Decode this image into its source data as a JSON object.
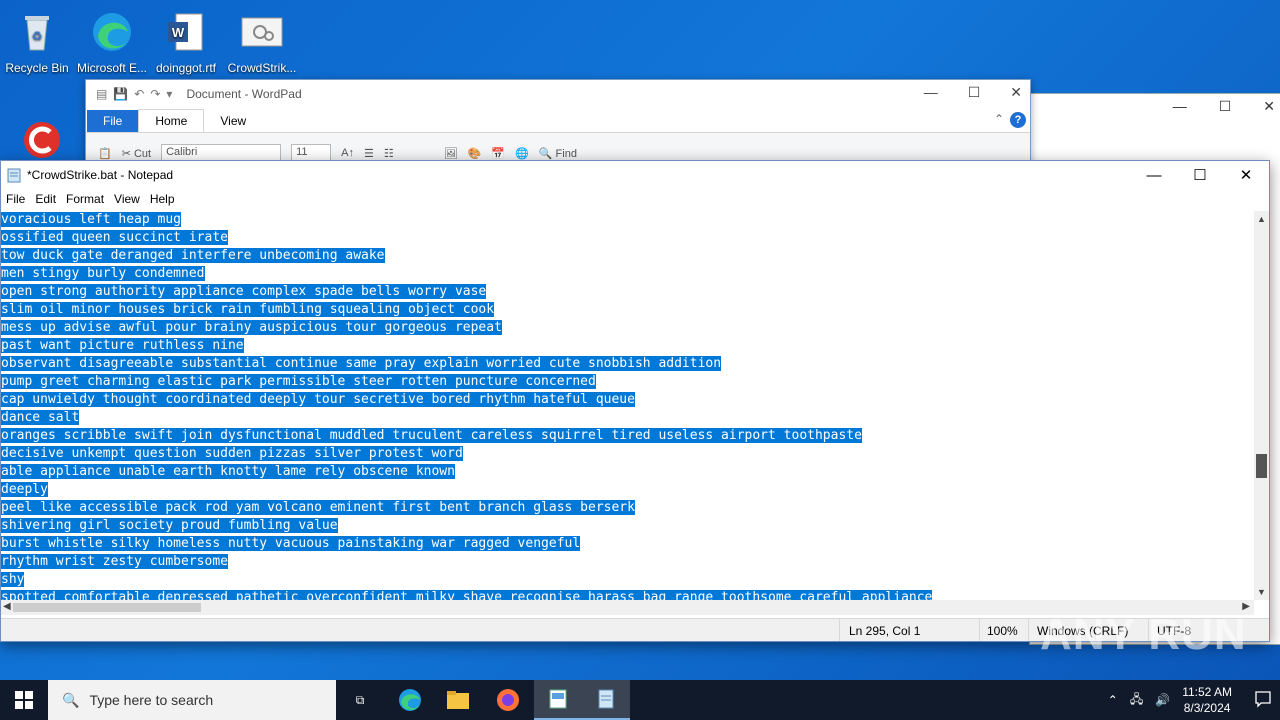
{
  "desktop": {
    "icons": [
      {
        "label": "Recycle Bin"
      },
      {
        "label": "Microsoft E..."
      },
      {
        "label": "doinggot.rtf"
      },
      {
        "label": "CrowdStrik..."
      }
    ]
  },
  "wordpad": {
    "title": "Document - WordPad",
    "tabs": [
      "File",
      "Home",
      "View"
    ],
    "font_name": "Calibri",
    "font_size": "11",
    "cut_label": "Cut",
    "find_label": "Find"
  },
  "notepad": {
    "title": "*CrowdStrike.bat - Notepad",
    "menu": [
      "File",
      "Edit",
      "Format",
      "View",
      "Help"
    ],
    "lines": [
      "voracious left heap mug",
      "ossified queen succinct irate",
      "tow duck gate deranged interfere unbecoming awake",
      "men stingy burly condemned",
      "open strong authority appliance complex spade bells worry vase",
      "slim oil minor houses brick rain fumbling squealing object cook",
      "mess up advise awful pour brainy auspicious tour gorgeous repeat",
      "past want picture ruthless nine",
      "observant disagreeable substantial continue same pray explain worried cute snobbish addition",
      "pump greet charming elastic park permissible steer rotten puncture concerned",
      "cap unwieldy thought coordinated deeply tour secretive bored rhythm hateful queue",
      "dance salt",
      "oranges scribble swift join dysfunctional muddled truculent careless squirrel tired useless airport toothpaste",
      "decisive unkempt question sudden pizzas silver protest word",
      "able appliance unable earth knotty lame rely obscene known",
      "deeply",
      "peel like accessible pack rod yam volcano eminent first bent branch glass berserk",
      "shivering girl society proud fumbling value",
      "burst whistle silky homeless nutty vacuous painstaking war ragged vengeful",
      "rhythm wrist zesty cumbersome",
      "shy",
      "spotted comfortable depressed pathetic overconfident milky shave recognise harass bag range toothsome careful appliance"
    ],
    "status": {
      "position": "Ln 295, Col 1",
      "zoom": "100%",
      "line_ending": "Windows (CRLF)",
      "encoding": "UTF-8"
    }
  },
  "taskbar": {
    "search_placeholder": "Type here to search",
    "time": "11:52 AM",
    "date": "8/3/2024"
  },
  "watermark": "ANY RUN"
}
